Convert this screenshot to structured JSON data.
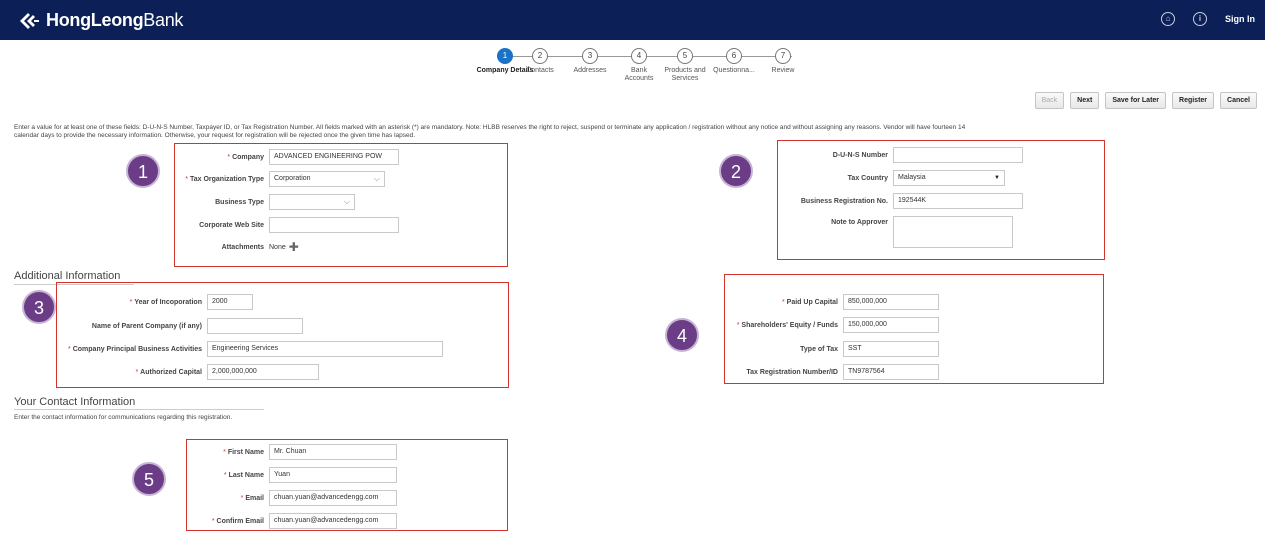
{
  "header": {
    "brand_bold": "HongLeong",
    "brand_thin": "Bank",
    "sign_in": "Sign In"
  },
  "train": [
    {
      "num": "1",
      "label": "Company Details",
      "active": true
    },
    {
      "num": "2",
      "label": "Contacts",
      "active": false
    },
    {
      "num": "3",
      "label": "Addresses",
      "active": false
    },
    {
      "num": "4",
      "label": "Bank Accounts",
      "active": false
    },
    {
      "num": "5",
      "label": "Products and Services",
      "active": false
    },
    {
      "num": "6",
      "label": "Questionna...",
      "active": false
    },
    {
      "num": "7",
      "label": "Review",
      "active": false
    }
  ],
  "actions": {
    "back": "Back",
    "next": "Next",
    "save_for_later": "Save for Later",
    "register": "Register",
    "cancel": "Cancel"
  },
  "notice": "Enter a value for at least one of these fields: D-U-N-S Number, Taxpayer ID, or Tax Registration Number. All fields marked with an asterisk (*) are mandatory. Note: HLBB reserves the right to reject, suspend or terminate any application / registration without any notice and without assigning any reasons. Vendor will have fourteen 14 calendar days to provide the necessary information. Otherwise, your request for registration will be rejected once the given time has lapsed.",
  "badges": [
    "1",
    "2",
    "3",
    "4",
    "5"
  ],
  "company": {
    "company_label": "Company",
    "company_value": "ADVANCED ENGINEERING POW",
    "tax_org_label": "Tax Organization Type",
    "tax_org_value": "Corporation",
    "business_type_label": "Business Type",
    "business_type_value": "",
    "website_label": "Corporate Web Site",
    "website_value": "",
    "attachments_label": "Attachments",
    "attachments_value": "None"
  },
  "tax": {
    "duns_label": "D-U-N-S Number",
    "duns_value": "",
    "country_label": "Tax Country",
    "country_value": "Malaysia",
    "brn_label": "Business Registration No.",
    "brn_value": "192544K",
    "note_label": "Note to Approver"
  },
  "additional": {
    "title": "Additional Information",
    "year_label": "Year of Incoporation",
    "year_value": "2000",
    "parent_label": "Name of Parent Company (if any)",
    "parent_value": "",
    "activities_label": "Company Principal Business Activities",
    "activities_value": "Engineering Services",
    "auth_capital_label": "Authorized Capital",
    "auth_capital_value": "2,000,000,000"
  },
  "financial": {
    "paid_label": "Paid Up Capital",
    "paid_value": "850,000,000",
    "equity_label": "Shareholders' Equity / Funds",
    "equity_value": "150,000,000",
    "type_tax_label": "Type of Tax",
    "type_tax_value": "SST",
    "trn_label": "Tax Registration Number/ID",
    "trn_value": "TN9787564"
  },
  "contact": {
    "title": "Your Contact Information",
    "subtitle": "Enter the contact information for communications regarding this registration.",
    "first_label": "First Name",
    "first_value": "Mr. Chuan",
    "last_label": "Last Name",
    "last_value": "Yuan",
    "email_label": "Email",
    "email_value": "chuan.yuan@advancedengg.com",
    "confirm_label": "Confirm Email",
    "confirm_value": "chuan.yuan@advancedengg.com"
  },
  "colors": {
    "header_bg": "#0c1f56",
    "accent": "#1a73c7",
    "highlight_box": "#d0342c",
    "badge": "#6b3d86"
  }
}
